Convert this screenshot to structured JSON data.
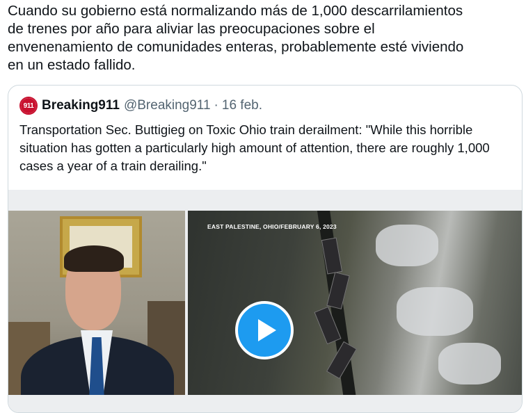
{
  "tweet": {
    "text": "Cuando su gobierno está normalizando más de 1,000 descarrilamientos\nde trenes por año para aliviar las preocupaciones sobre el\nenvenenamiento de comunidades enteras, probablemente esté viviendo\nen un estado fallido."
  },
  "quoted_tweet": {
    "avatar_text": "911",
    "display_name": "Breaking911",
    "handle": "@Breaking911",
    "separator": "·",
    "date": "16 feb.",
    "text": "Transportation Sec. Buttigieg on Toxic Ohio train derailment: \"While this horrible situation has gotten a particularly high amount of attention, there are roughly 1,000 cases a year of a train derailing.\"",
    "media": {
      "video_caption": "EAST PALESTINE, OHIO/FEBRUARY 6, 2023",
      "play_icon": "play-icon"
    }
  },
  "colors": {
    "text": "#0f1419",
    "secondary_text": "#536471",
    "border": "#cfd9de",
    "accent": "#1d9bf0",
    "avatar_red": "#c8102e"
  }
}
